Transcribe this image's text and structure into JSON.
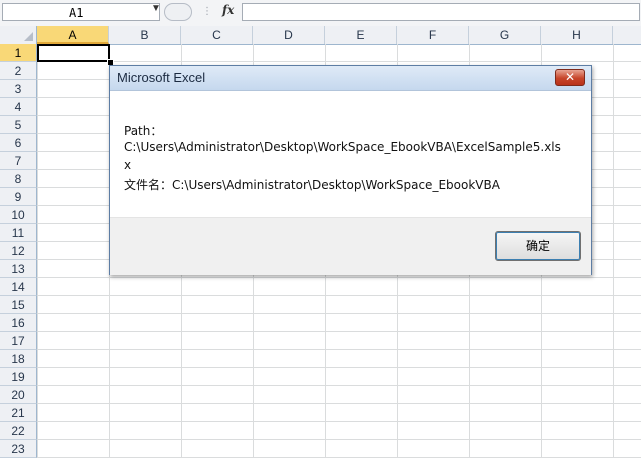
{
  "formula_bar": {
    "name_box": "A1",
    "fx_label": "fx",
    "formula_value": ""
  },
  "columns": [
    "A",
    "B",
    "C",
    "D",
    "E",
    "F",
    "G",
    "H"
  ],
  "rows": [
    "1",
    "2",
    "3",
    "4",
    "5",
    "6",
    "7",
    "8",
    "9",
    "10",
    "11",
    "12",
    "13",
    "14",
    "15",
    "16",
    "17",
    "18",
    "19",
    "20",
    "21",
    "22",
    "23"
  ],
  "active_cell": {
    "column": "A",
    "row": "1"
  },
  "dialog": {
    "title": "Microsoft Excel",
    "lines": [
      "Path：",
      "C:\\Users\\Administrator\\Desktop\\WorkSpace_EbookVBA\\ExcelSample5.xls",
      "x",
      "文件名：C:\\Users\\Administrator\\Desktop\\WorkSpace_EbookVBA"
    ],
    "ok_label": "确定",
    "close_glyph": "✕"
  },
  "colors": {
    "active_header": "#f9d877",
    "dialog_border": "#5d7da4",
    "close_button": "#c7452a"
  }
}
